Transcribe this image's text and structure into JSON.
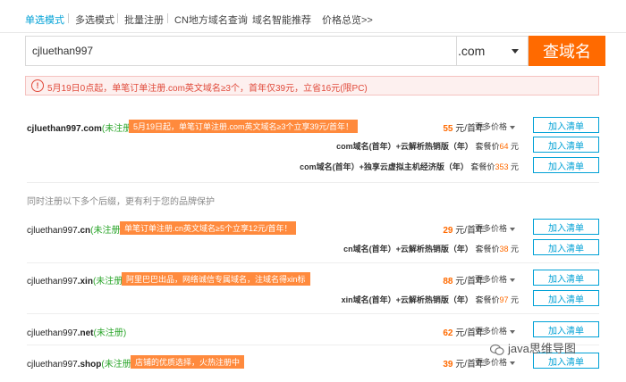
{
  "nav": {
    "tabs": [
      "单选模式",
      "多选模式",
      "批量注册",
      "CN地方域名查询",
      "域名智能推荐",
      "价格总览>>"
    ]
  },
  "search": {
    "value": "cjluethan997",
    "tld": ".com",
    "button": "查域名"
  },
  "notice": {
    "text": "5月19日0点起，单笔订单注册.com英文域名≥3个，首年仅39元，立省16元(限PC)"
  },
  "labels": {
    "add": "加入清单",
    "more": "更多价格",
    "per_year": "元/首年",
    "combo_prefix": "套餐价",
    "yuan": "元"
  },
  "colors": {
    "accent": "#00a1d6",
    "brand": "#ff6a00",
    "available": "#2aa52a",
    "promo": "#ff8a3d"
  },
  "main_result": {
    "domain": "cjluethan997.com",
    "status": "(未注册)",
    "promo": "5月19日起，单笔订单注册.com英文域名≥3个立享39元/首年！",
    "price": "55",
    "combos": [
      {
        "name": "com域名(首年）+云解析热销版（年）",
        "price": "64"
      },
      {
        "name": "com域名(首年）+独享云虚拟主机经济版（年）",
        "price": "353"
      }
    ]
  },
  "group_label": "同时注册以下多个后缀，更有利于您的品牌保护",
  "results": [
    {
      "name": "cjluethan997",
      "tld": ".cn",
      "status": "(未注册)",
      "promo": "单笔订单注册.cn英文域名≥5个立享12元/首年！",
      "price": "29",
      "combo": {
        "name": "cn域名(首年）+云解析热销版（年）",
        "price": "38"
      }
    },
    {
      "name": "cjluethan997",
      "tld": ".xin",
      "status": "(未注册)",
      "promo": "阿里巴巴出品，网络诚信专属域名，注域名得xin标",
      "price": "88",
      "combo": {
        "name": "xin域名(首年）+云解析热销版（年）",
        "price": "97"
      }
    },
    {
      "name": "cjluethan997",
      "tld": ".net",
      "status": "(未注册)",
      "promo": "",
      "price": "62",
      "combo": null
    },
    {
      "name": "cjluethan997",
      "tld": ".shop",
      "status": "(未注册)",
      "promo": "店铺的优质选择，火热注册中",
      "price": "39",
      "combo": null
    }
  ],
  "watermark": "java思维导图"
}
